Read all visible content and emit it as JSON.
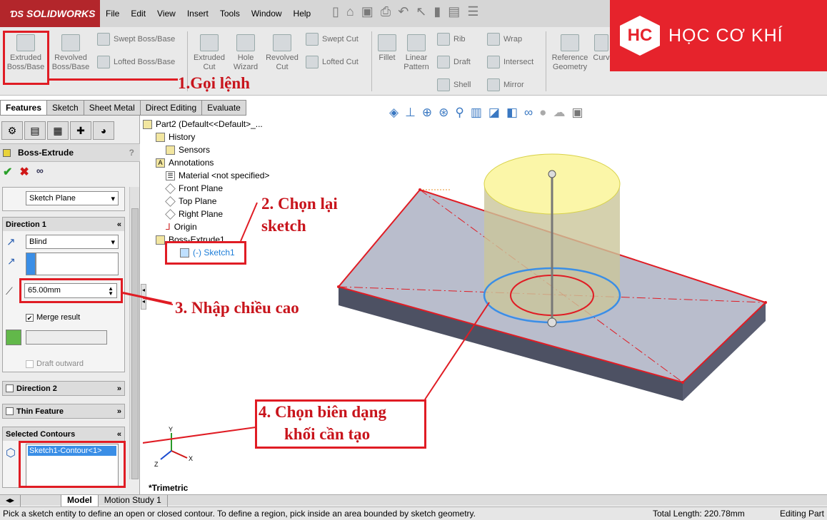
{
  "app": {
    "logo": "SOLIDWORKS"
  },
  "menu": [
    "File",
    "Edit",
    "View",
    "Insert",
    "Tools",
    "Window",
    "Help"
  ],
  "ribbon": {
    "extruded_boss": "Extruded Boss/Base",
    "revolved_boss": "Revolved Boss/Base",
    "swept_boss": "Swept Boss/Base",
    "lofted_boss": "Lofted Boss/Base",
    "extruded_cut": "Extruded Cut",
    "hole_wizard": "Hole Wizard",
    "revolved_cut": "Revolved Cut",
    "swept_cut": "Swept Cut",
    "lofted_cut": "Lofted Cut",
    "fillet": "Fillet",
    "linear_pattern": "Linear Pattern",
    "rib": "Rib",
    "draft": "Draft",
    "shell": "Shell",
    "wrap": "Wrap",
    "intersect": "Intersect",
    "mirror": "Mirror",
    "reference_geometry": "Reference Geometry",
    "curves": "Curv"
  },
  "brand": {
    "text": "HỌC CƠ KHÍ"
  },
  "tabs": [
    "Features",
    "Sketch",
    "Sheet Metal",
    "Direct Editing",
    "Evaluate"
  ],
  "property_manager": {
    "title": "Boss-Extrude",
    "help": "?",
    "from_select": "Sketch Plane",
    "direction1": {
      "title": "Direction 1",
      "end_condition": "Blind",
      "depth": "65.00mm",
      "merge_result": "Merge result",
      "draft_outward": "Draft outward"
    },
    "direction2": {
      "title": "Direction 2"
    },
    "thin_feature": {
      "title": "Thin Feature"
    },
    "selected_contours": {
      "title": "Selected Contours",
      "item": "Sketch1-Contour<1>"
    }
  },
  "tree": {
    "root": "Part2  (Default<<Default>_...",
    "items": [
      "History",
      "Sensors",
      "Annotations",
      "Material <not specified>",
      "Front Plane",
      "Top Plane",
      "Right Plane",
      "Origin",
      "Boss-Extrude1"
    ],
    "sketch": "(-) Sketch1"
  },
  "viewport": {
    "view_name": "*Trimetric"
  },
  "annotations": {
    "step1": "1.Gọi lệnh",
    "step2a": "2. Chọn lại",
    "step2b": "sketch",
    "step3": "3. Nhập chiều cao",
    "step4a": "4.  Chọn biên dạng",
    "step4b": "khối cần tạo"
  },
  "bottom_tabs": [
    "Model",
    "Motion Study 1"
  ],
  "status": {
    "message": "Pick a sketch entity to define an open or closed contour. To define a region, pick inside an area bounded by sketch geometry.",
    "total_length": "Total Length: 220.78mm",
    "mode": "Editing Part"
  },
  "colors": {
    "accent_red": "#e01c24",
    "brand_red": "#e6232c",
    "solidworks_red": "#b3262b",
    "selection_blue": "#3a8ee6"
  }
}
